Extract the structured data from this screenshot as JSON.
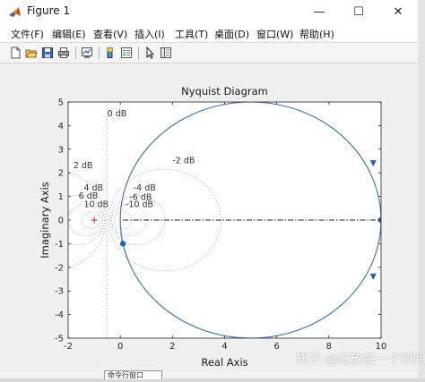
{
  "window": {
    "title": "Figure 1",
    "controls": {
      "minimize": "—",
      "maximize": "☐",
      "close": "✕"
    }
  },
  "menubar": [
    "文件(F)",
    "编辑(E)",
    "查看(V)",
    "插入(I)",
    "工具(T)",
    "桌面(D)",
    "窗口(W)",
    "帮助(H)"
  ],
  "toolbar": [
    {
      "name": "new-figure-icon"
    },
    {
      "name": "open-file-icon"
    },
    {
      "name": "save-icon"
    },
    {
      "name": "print-icon"
    },
    {
      "name": "link-plot-icon"
    },
    {
      "name": "insert-colorbar-icon"
    },
    {
      "name": "insert-legend-icon"
    },
    {
      "name": "edit-plot-pointer-icon"
    },
    {
      "name": "property-inspector-icon"
    }
  ],
  "command_window_tab": "命令行窗口",
  "watermark": "知乎 @绽放每一个瞬间",
  "colors": {
    "curve": "#3a6ea5",
    "marker": "#1f66b4",
    "grid": "#999999",
    "critical_point": "#d62020"
  },
  "chart_data": {
    "type": "line",
    "title": "Nyquist Diagram",
    "xlabel": "Real Axis",
    "ylabel": "Imaginary Axis",
    "xlim": [
      -2,
      10
    ],
    "ylim": [
      -5,
      5
    ],
    "xticks": [
      -2,
      0,
      2,
      4,
      6,
      8,
      10
    ],
    "yticks": [
      -5,
      -4,
      -3,
      -2,
      -1,
      0,
      1,
      2,
      3,
      4,
      5
    ],
    "grid": "M-circles (dB)",
    "series": [
      {
        "shape": "circle",
        "center": [
          5,
          0
        ],
        "radius": 5,
        "direction_arrows_at": [
          [
            9.7,
            2.4
          ],
          [
            9.7,
            -2.4
          ]
        ]
      }
    ],
    "markers": [
      [
        10,
        0
      ],
      [
        0.1,
        -1
      ]
    ],
    "critical_point": [
      -1,
      0
    ],
    "real_axis_line": [
      0.1,
      10
    ],
    "m_circle_labels": [
      {
        "text": "0 dB",
        "x": -0.5,
        "y": 4.4
      },
      {
        "text": "-2 dB",
        "x": 2.0,
        "y": 2.4
      },
      {
        "text": "2 dB",
        "x": -1.8,
        "y": 2.2
      },
      {
        "text": "4 dB",
        "x": -1.4,
        "y": 1.25
      },
      {
        "text": "-4 dB",
        "x": 0.5,
        "y": 1.25
      },
      {
        "text": "6 dB",
        "x": -1.6,
        "y": 0.9
      },
      {
        "text": "-6 dB",
        "x": 0.35,
        "y": 0.85
      },
      {
        "text": "10 dB",
        "x": -1.4,
        "y": 0.55
      },
      {
        "text": "-10 dB",
        "x": 0.2,
        "y": 0.55
      }
    ]
  }
}
